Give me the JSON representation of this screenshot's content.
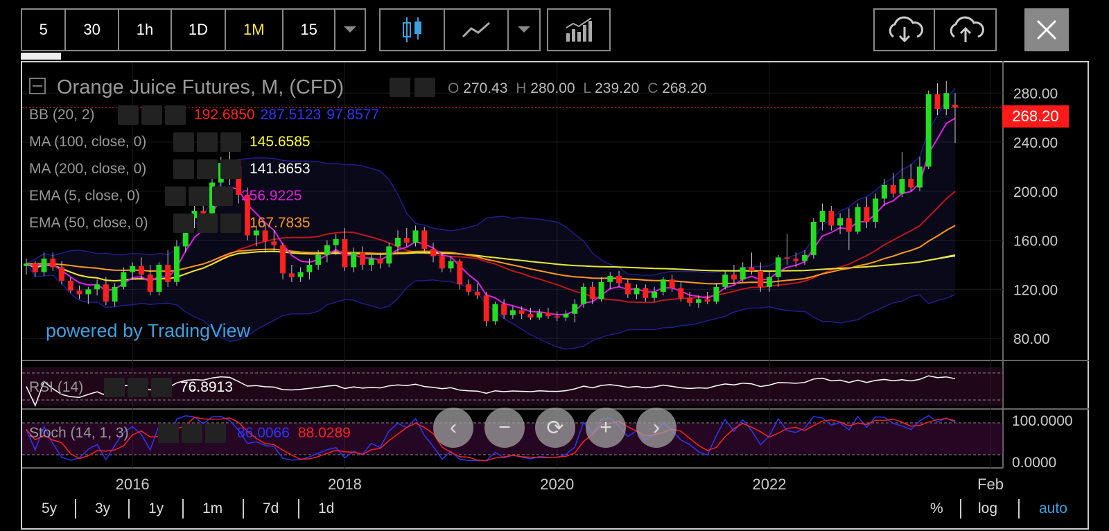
{
  "toolbar": {
    "intervals": [
      "5",
      "30",
      "1h",
      "1D",
      "1M",
      "15"
    ],
    "active_interval": "1M"
  },
  "legend": {
    "symbol_title": "Orange Juice Futures, M, (CFD)",
    "ohlc": {
      "o_label": "O",
      "o": "270.43",
      "h_label": "H",
      "h": "280.00",
      "l_label": "L",
      "l": "239.20",
      "c_label": "C",
      "c": "268.20"
    },
    "indicators": [
      {
        "label": "BB (20, 2)",
        "values": [
          "192.6850",
          "287.5123",
          "97.8577"
        ],
        "colors": [
          "#ff2020",
          "#2f35ff",
          "#2f35ff"
        ]
      },
      {
        "label": "MA (100, close, 0)",
        "values": [
          "145.6585"
        ],
        "colors": [
          "#ffff33"
        ]
      },
      {
        "label": "MA (200, close, 0)",
        "values": [
          "141.8653"
        ],
        "colors": [
          "#ffffff"
        ]
      },
      {
        "label": "EMA (5, close, 0)",
        "values": [
          "256.9225"
        ],
        "colors": [
          "#e020e0"
        ]
      },
      {
        "label": "EMA (50, close, 0)",
        "values": [
          "167.7835"
        ],
        "colors": [
          "#ff9a1a"
        ]
      }
    ]
  },
  "price_tag": "268.20",
  "watermark": "powered by TradingView",
  "rsi": {
    "label": "RSI (14)",
    "value": "76.8913"
  },
  "stoch": {
    "label": "Stoch (14, 1, 3)",
    "k": "86.0066",
    "d": "88.0289",
    "levels": [
      "100.0000",
      "0.0000"
    ]
  },
  "ranges": [
    "5y",
    "3y",
    "1y",
    "1m",
    "7d",
    "1d"
  ],
  "scale_options": [
    "%",
    "log",
    "auto"
  ],
  "colors": {
    "active": "#ffeb3b",
    "up": "#22dd22",
    "down": "#ff2020",
    "accent_blue": "#3fa0e0"
  },
  "chart_data": {
    "type": "candlestick",
    "title": "Orange Juice Futures, M, (CFD)",
    "x_ticks": [
      "2016",
      "2018",
      "2020",
      "2022",
      "Feb"
    ],
    "y_ticks": [
      80,
      120,
      160,
      200,
      240,
      280
    ],
    "ylim": [
      62,
      305
    ],
    "candles": [
      {
        "t": "2015-01",
        "o": 139,
        "h": 145,
        "l": 132,
        "c": 141
      },
      {
        "t": "2015-02",
        "o": 141,
        "h": 143,
        "l": 130,
        "c": 134
      },
      {
        "t": "2015-03",
        "o": 134,
        "h": 150,
        "l": 131,
        "c": 145
      },
      {
        "t": "2015-04",
        "o": 145,
        "h": 150,
        "l": 135,
        "c": 138
      },
      {
        "t": "2015-05",
        "o": 138,
        "h": 143,
        "l": 124,
        "c": 127
      },
      {
        "t": "2015-06",
        "o": 127,
        "h": 130,
        "l": 117,
        "c": 119
      },
      {
        "t": "2015-07",
        "o": 119,
        "h": 123,
        "l": 112,
        "c": 116
      },
      {
        "t": "2015-08",
        "o": 116,
        "h": 122,
        "l": 108,
        "c": 120
      },
      {
        "t": "2015-09",
        "o": 120,
        "h": 128,
        "l": 115,
        "c": 124
      },
      {
        "t": "2015-10",
        "o": 124,
        "h": 130,
        "l": 107,
        "c": 110
      },
      {
        "t": "2015-11",
        "o": 110,
        "h": 125,
        "l": 106,
        "c": 122
      },
      {
        "t": "2015-12",
        "o": 122,
        "h": 138,
        "l": 120,
        "c": 134
      },
      {
        "t": "2016-01",
        "o": 134,
        "h": 142,
        "l": 128,
        "c": 139
      },
      {
        "t": "2016-02",
        "o": 139,
        "h": 146,
        "l": 128,
        "c": 132
      },
      {
        "t": "2016-03",
        "o": 132,
        "h": 140,
        "l": 115,
        "c": 118
      },
      {
        "t": "2016-04",
        "o": 118,
        "h": 142,
        "l": 115,
        "c": 140
      },
      {
        "t": "2016-05",
        "o": 140,
        "h": 152,
        "l": 122,
        "c": 126
      },
      {
        "t": "2016-06",
        "o": 126,
        "h": 160,
        "l": 123,
        "c": 155
      },
      {
        "t": "2016-07",
        "o": 155,
        "h": 180,
        "l": 150,
        "c": 178
      },
      {
        "t": "2016-08",
        "o": 178,
        "h": 188,
        "l": 170,
        "c": 184
      },
      {
        "t": "2016-09",
        "o": 184,
        "h": 200,
        "l": 176,
        "c": 182
      },
      {
        "t": "2016-10",
        "o": 182,
        "h": 212,
        "l": 178,
        "c": 207
      },
      {
        "t": "2016-11",
        "o": 207,
        "h": 228,
        "l": 198,
        "c": 223
      },
      {
        "t": "2016-12",
        "o": 223,
        "h": 236,
        "l": 205,
        "c": 220
      },
      {
        "t": "2017-01",
        "o": 220,
        "h": 226,
        "l": 190,
        "c": 197
      },
      {
        "t": "2017-02",
        "o": 197,
        "h": 203,
        "l": 160,
        "c": 164
      },
      {
        "t": "2017-03",
        "o": 164,
        "h": 172,
        "l": 155,
        "c": 168
      },
      {
        "t": "2017-04",
        "o": 168,
        "h": 173,
        "l": 150,
        "c": 159
      },
      {
        "t": "2017-05",
        "o": 159,
        "h": 168,
        "l": 150,
        "c": 156
      },
      {
        "t": "2017-06",
        "o": 156,
        "h": 158,
        "l": 128,
        "c": 133
      },
      {
        "t": "2017-07",
        "o": 133,
        "h": 140,
        "l": 126,
        "c": 130
      },
      {
        "t": "2017-08",
        "o": 130,
        "h": 138,
        "l": 126,
        "c": 134
      },
      {
        "t": "2017-09",
        "o": 134,
        "h": 145,
        "l": 128,
        "c": 140
      },
      {
        "t": "2017-10",
        "o": 140,
        "h": 152,
        "l": 136,
        "c": 148
      },
      {
        "t": "2017-11",
        "o": 148,
        "h": 160,
        "l": 142,
        "c": 156
      },
      {
        "t": "2017-12",
        "o": 156,
        "h": 165,
        "l": 148,
        "c": 161
      },
      {
        "t": "2018-01",
        "o": 161,
        "h": 170,
        "l": 135,
        "c": 138
      },
      {
        "t": "2018-02",
        "o": 138,
        "h": 154,
        "l": 134,
        "c": 150
      },
      {
        "t": "2018-03",
        "o": 150,
        "h": 155,
        "l": 136,
        "c": 140
      },
      {
        "t": "2018-04",
        "o": 140,
        "h": 148,
        "l": 135,
        "c": 145
      },
      {
        "t": "2018-05",
        "o": 145,
        "h": 150,
        "l": 137,
        "c": 141
      },
      {
        "t": "2018-06",
        "o": 141,
        "h": 158,
        "l": 138,
        "c": 155
      },
      {
        "t": "2018-07",
        "o": 155,
        "h": 168,
        "l": 150,
        "c": 162
      },
      {
        "t": "2018-08",
        "o": 162,
        "h": 170,
        "l": 155,
        "c": 158
      },
      {
        "t": "2018-09",
        "o": 158,
        "h": 172,
        "l": 155,
        "c": 168
      },
      {
        "t": "2018-10",
        "o": 168,
        "h": 171,
        "l": 150,
        "c": 153
      },
      {
        "t": "2018-11",
        "o": 153,
        "h": 158,
        "l": 142,
        "c": 147
      },
      {
        "t": "2018-12",
        "o": 147,
        "h": 150,
        "l": 134,
        "c": 137
      },
      {
        "t": "2019-01",
        "o": 137,
        "h": 147,
        "l": 134,
        "c": 143
      },
      {
        "t": "2019-02",
        "o": 143,
        "h": 145,
        "l": 120,
        "c": 124
      },
      {
        "t": "2019-03",
        "o": 124,
        "h": 128,
        "l": 115,
        "c": 118
      },
      {
        "t": "2019-04",
        "o": 118,
        "h": 125,
        "l": 112,
        "c": 115
      },
      {
        "t": "2019-05",
        "o": 115,
        "h": 118,
        "l": 90,
        "c": 94
      },
      {
        "t": "2019-06",
        "o": 94,
        "h": 110,
        "l": 91,
        "c": 108
      },
      {
        "t": "2019-07",
        "o": 108,
        "h": 112,
        "l": 96,
        "c": 99
      },
      {
        "t": "2019-08",
        "o": 99,
        "h": 106,
        "l": 96,
        "c": 103
      },
      {
        "t": "2019-09",
        "o": 103,
        "h": 106,
        "l": 96,
        "c": 100
      },
      {
        "t": "2019-10",
        "o": 100,
        "h": 105,
        "l": 95,
        "c": 97
      },
      {
        "t": "2019-11",
        "o": 97,
        "h": 104,
        "l": 95,
        "c": 101
      },
      {
        "t": "2019-12",
        "o": 101,
        "h": 105,
        "l": 96,
        "c": 98
      },
      {
        "t": "2020-01",
        "o": 98,
        "h": 102,
        "l": 94,
        "c": 97
      },
      {
        "t": "2020-02",
        "o": 97,
        "h": 103,
        "l": 94,
        "c": 100
      },
      {
        "t": "2020-03",
        "o": 100,
        "h": 112,
        "l": 93,
        "c": 108
      },
      {
        "t": "2020-04",
        "o": 108,
        "h": 125,
        "l": 105,
        "c": 122
      },
      {
        "t": "2020-05",
        "o": 122,
        "h": 126,
        "l": 108,
        "c": 112
      },
      {
        "t": "2020-06",
        "o": 112,
        "h": 130,
        "l": 110,
        "c": 126
      },
      {
        "t": "2020-07",
        "o": 126,
        "h": 134,
        "l": 120,
        "c": 131
      },
      {
        "t": "2020-08",
        "o": 131,
        "h": 135,
        "l": 122,
        "c": 125
      },
      {
        "t": "2020-09",
        "o": 125,
        "h": 128,
        "l": 113,
        "c": 116
      },
      {
        "t": "2020-10",
        "o": 116,
        "h": 124,
        "l": 112,
        "c": 121
      },
      {
        "t": "2020-11",
        "o": 121,
        "h": 124,
        "l": 110,
        "c": 113
      },
      {
        "t": "2020-12",
        "o": 113,
        "h": 122,
        "l": 110,
        "c": 118
      },
      {
        "t": "2021-01",
        "o": 118,
        "h": 130,
        "l": 115,
        "c": 128
      },
      {
        "t": "2021-02",
        "o": 128,
        "h": 132,
        "l": 118,
        "c": 121
      },
      {
        "t": "2021-03",
        "o": 121,
        "h": 126,
        "l": 110,
        "c": 113
      },
      {
        "t": "2021-04",
        "o": 113,
        "h": 118,
        "l": 106,
        "c": 109
      },
      {
        "t": "2021-05",
        "o": 109,
        "h": 115,
        "l": 105,
        "c": 112
      },
      {
        "t": "2021-06",
        "o": 112,
        "h": 118,
        "l": 108,
        "c": 110
      },
      {
        "t": "2021-07",
        "o": 110,
        "h": 125,
        "l": 108,
        "c": 122
      },
      {
        "t": "2021-08",
        "o": 122,
        "h": 135,
        "l": 120,
        "c": 132
      },
      {
        "t": "2021-09",
        "o": 132,
        "h": 140,
        "l": 125,
        "c": 128
      },
      {
        "t": "2021-10",
        "o": 128,
        "h": 142,
        "l": 126,
        "c": 138
      },
      {
        "t": "2021-11",
        "o": 138,
        "h": 150,
        "l": 132,
        "c": 135
      },
      {
        "t": "2021-12",
        "o": 135,
        "h": 142,
        "l": 118,
        "c": 122
      },
      {
        "t": "2022-01",
        "o": 122,
        "h": 135,
        "l": 118,
        "c": 130
      },
      {
        "t": "2022-02",
        "o": 130,
        "h": 148,
        "l": 122,
        "c": 146
      },
      {
        "t": "2022-03",
        "o": 146,
        "h": 165,
        "l": 140,
        "c": 145
      },
      {
        "t": "2022-04",
        "o": 145,
        "h": 150,
        "l": 138,
        "c": 143
      },
      {
        "t": "2022-05",
        "o": 143,
        "h": 152,
        "l": 140,
        "c": 148
      },
      {
        "t": "2022-06",
        "o": 148,
        "h": 178,
        "l": 145,
        "c": 175
      },
      {
        "t": "2022-07",
        "o": 175,
        "h": 190,
        "l": 168,
        "c": 184
      },
      {
        "t": "2022-08",
        "o": 184,
        "h": 188,
        "l": 168,
        "c": 172
      },
      {
        "t": "2022-09",
        "o": 172,
        "h": 182,
        "l": 165,
        "c": 178
      },
      {
        "t": "2022-10",
        "o": 178,
        "h": 186,
        "l": 152,
        "c": 167
      },
      {
        "t": "2022-11",
        "o": 167,
        "h": 190,
        "l": 165,
        "c": 187
      },
      {
        "t": "2022-12",
        "o": 187,
        "h": 195,
        "l": 170,
        "c": 175
      },
      {
        "t": "2023-01",
        "o": 175,
        "h": 198,
        "l": 170,
        "c": 194
      },
      {
        "t": "2023-02",
        "o": 194,
        "h": 210,
        "l": 188,
        "c": 205
      },
      {
        "t": "2023-03",
        "o": 205,
        "h": 215,
        "l": 195,
        "c": 198
      },
      {
        "t": "2023-04",
        "o": 198,
        "h": 232,
        "l": 195,
        "c": 210
      },
      {
        "t": "2023-05",
        "o": 210,
        "h": 222,
        "l": 200,
        "c": 203
      },
      {
        "t": "2023-06",
        "o": 203,
        "h": 228,
        "l": 200,
        "c": 220
      },
      {
        "t": "2023-07",
        "o": 220,
        "h": 282,
        "l": 218,
        "c": 279
      },
      {
        "t": "2023-08",
        "o": 279,
        "h": 288,
        "l": 262,
        "c": 267
      },
      {
        "t": "2023-09",
        "o": 267,
        "h": 290,
        "l": 262,
        "c": 280
      },
      {
        "t": "2023-10",
        "o": 270.43,
        "h": 280.0,
        "l": 239.2,
        "c": 268.2
      }
    ]
  }
}
